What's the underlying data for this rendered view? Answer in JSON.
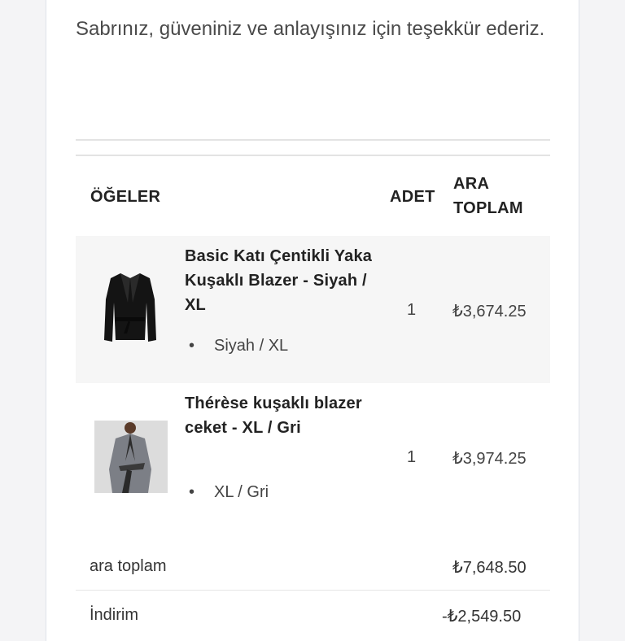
{
  "intro": "Sabrınız, güveniniz ve anlayışınız için teşekkür ederiz.",
  "table": {
    "header_items": "ÖĞELER",
    "header_qty": "ADET",
    "header_subtotal_line1": "ARA",
    "header_subtotal_line2": "TOPLAM"
  },
  "items": [
    {
      "name": "Basic Katı Çentikli Yaka Kuşaklı Blazer - Siyah / XL",
      "variant": "Siyah / XL",
      "qty": "1",
      "price": "₺3,674.25",
      "image": "black-blazer"
    },
    {
      "name": "Thérèse kuşaklı blazer ceket - XL / Gri",
      "variant": "XL / Gri",
      "qty": "1",
      "price": "₺3,974.25",
      "image": "grey-blazer-model"
    }
  ],
  "summary": {
    "subtotal_label": "ara toplam",
    "subtotal_value": "₺7,648.50",
    "discount_label": "İndirim",
    "discount_value": "-₺2,549.50"
  },
  "colors": {
    "page_bg": "#f4f4f6",
    "card_bg": "#ffffff",
    "row_highlight": "#f6f6f6",
    "text": "#2b2b2b"
  }
}
